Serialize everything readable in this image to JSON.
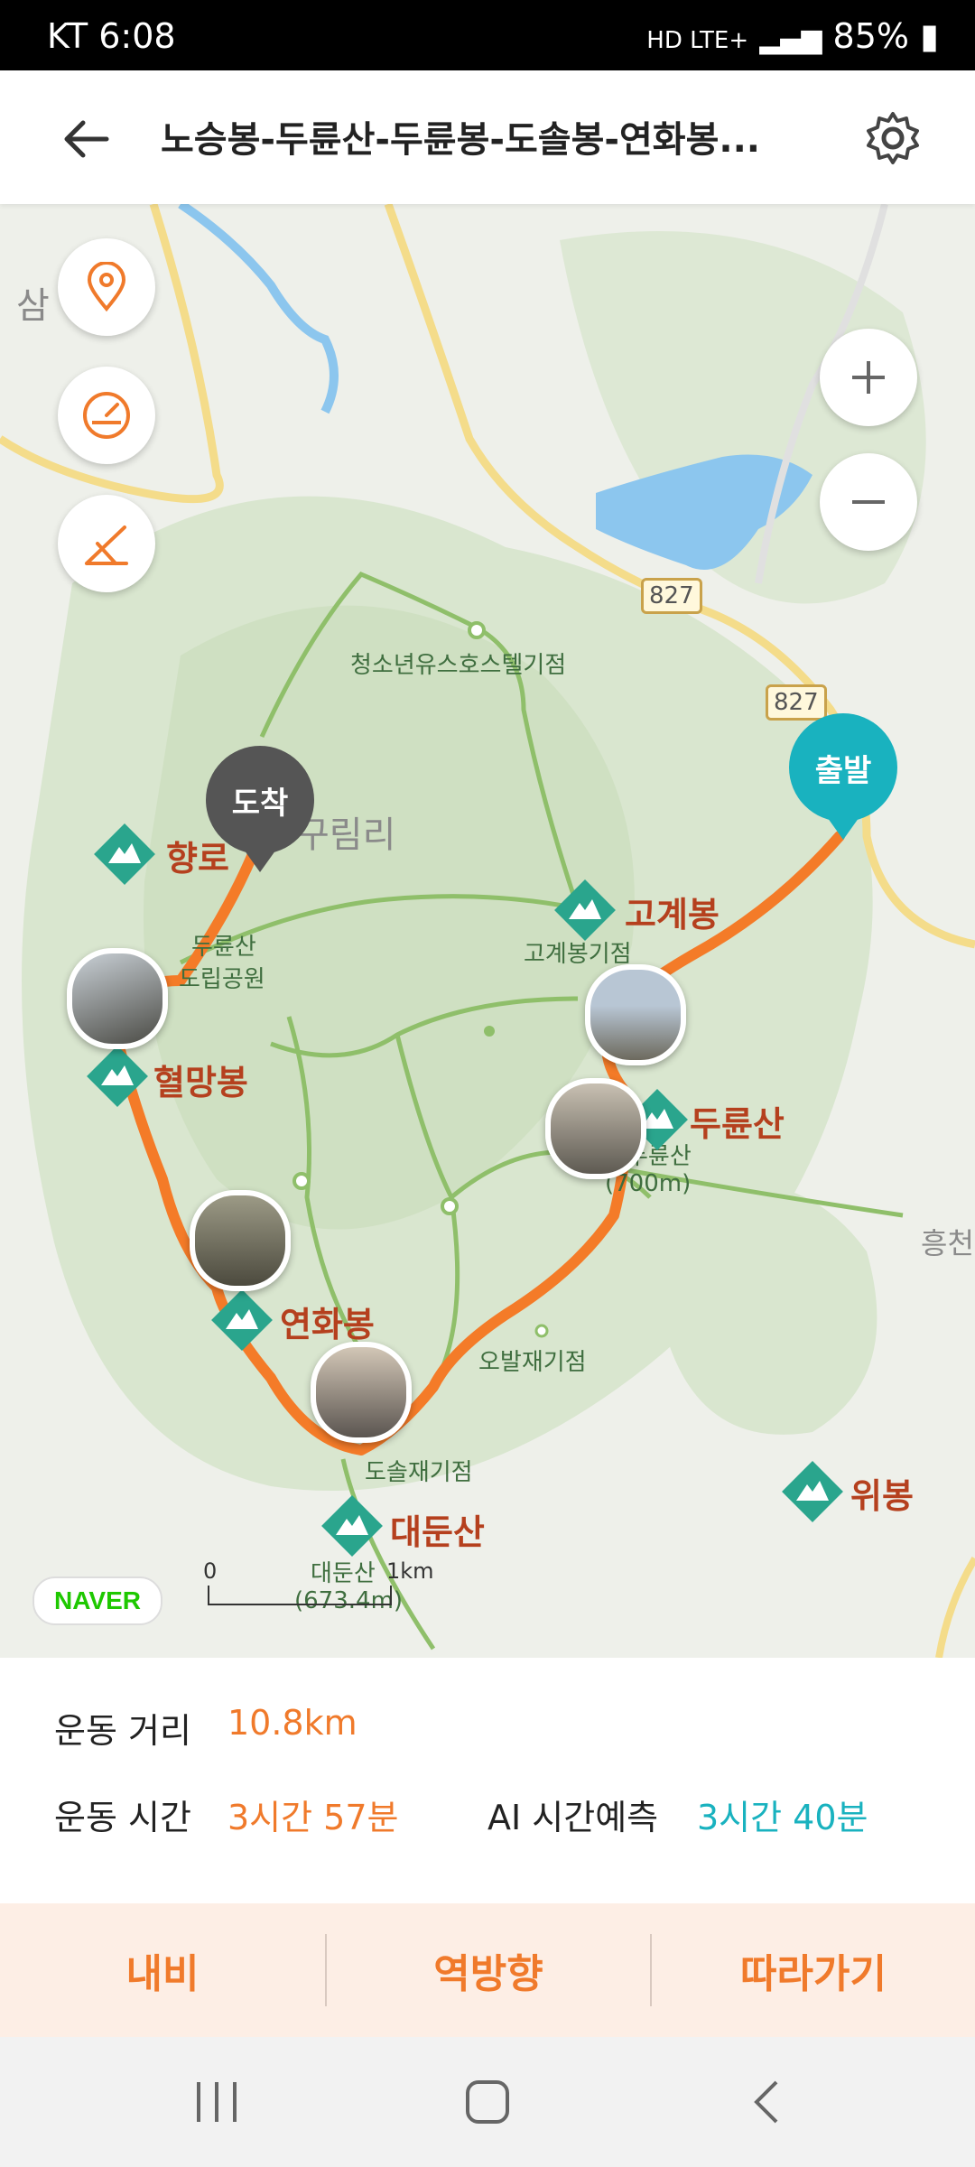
{
  "status_bar": {
    "carrier_time": "KT 6:08",
    "network": "HD LTE+",
    "battery": "85%"
  },
  "header": {
    "title": "노승봉-두륜산-두륜봉-도솔봉-연화봉...",
    "back_icon": "back-arrow-icon",
    "settings_icon": "gear-icon"
  },
  "map": {
    "town_partial": "삼",
    "village": "구림리",
    "route_no_1": "827",
    "route_no_2": "827",
    "peaks": {
      "hyangro": "향로",
      "gogye": "고계봉",
      "hyeolmang": "혈망봉",
      "duryun": "두륜산",
      "yeonhwa": "연화봉",
      "daedun": "대둔산",
      "wibong": "위봉"
    },
    "small_labels": {
      "youth_hostel": "청소년유스호스텔기점",
      "gogye_sub": "고계봉기점",
      "park_1": "두륜산",
      "park_2": "도립공원",
      "duryun_sub_1": "두륜산",
      "duryun_sub_2": "(700m)",
      "obal": "오발재기점",
      "dosol": "도솔재기점",
      "daedun_sub_1": "대둔산",
      "daedun_sub_2": "(673.4m)",
      "heungchon": "흥천"
    },
    "start_pin": "출발",
    "end_pin": "도착",
    "brand": "NAVER",
    "scale_zero": "0",
    "scale_unit": "1km",
    "colors": {
      "route": "#f47b28",
      "start": "#19b2bf",
      "end": "#555555",
      "peak_label": "#b5401e",
      "peak_icon": "#2aa58d"
    }
  },
  "stats": {
    "distance_label": "운동 거리",
    "distance_value": "10.8km",
    "time_label": "운동 시간",
    "time_value": "3시간 57분",
    "ai_label": "AI 시간예측",
    "ai_value": "3시간 40분"
  },
  "actions": {
    "navigate": "내비",
    "reverse": "역방향",
    "follow": "따라가기"
  }
}
